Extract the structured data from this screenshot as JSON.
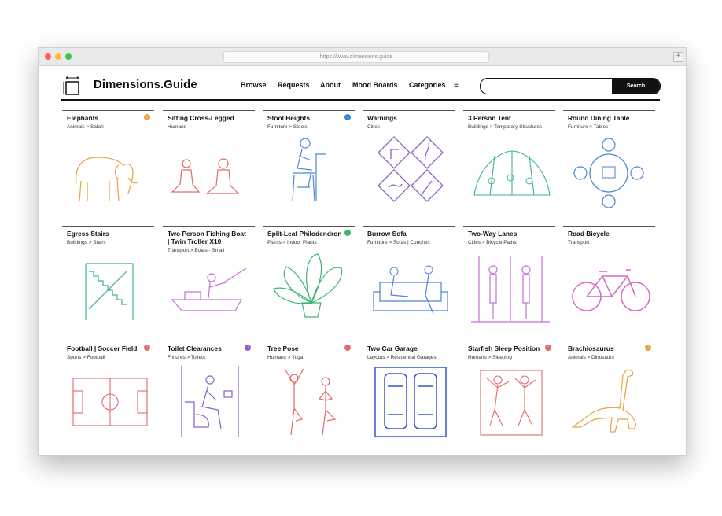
{
  "browser": {
    "url": "https://www.dimensions.guide",
    "new_tab_icon": "+"
  },
  "site": {
    "brand": "Dimensions.Guide",
    "logo_icon": "dimensions-logo-icon"
  },
  "nav": {
    "browse": "Browse",
    "requests": "Requests",
    "about": "About",
    "mood_boards": "Mood Boards",
    "categories": "Categories",
    "menu_icon": "≡"
  },
  "search": {
    "placeholder": "",
    "button": "Search"
  },
  "cards": [
    {
      "title": "Elephants",
      "sub": "Animals > Safari",
      "color": "#e8a243",
      "icon": "elephant-icon",
      "badge": "orange"
    },
    {
      "title": "Sitting Cross-Legged",
      "sub": "Humans",
      "color": "#e36a6a",
      "icon": "sitting-people-icon",
      "badge": ""
    },
    {
      "title": "Stool Heights",
      "sub": "Furniture > Stools",
      "color": "#4a86d6",
      "icon": "stool-person-icon",
      "badge": "blue"
    },
    {
      "title": "Warnings",
      "sub": "Cities",
      "color": "#8a5fc7",
      "icon": "warning-signs-icon",
      "badge": ""
    },
    {
      "title": "3 Person Tent",
      "sub": "Buildings > Temporary Structures",
      "color": "#3db58a",
      "icon": "tent-icon",
      "badge": ""
    },
    {
      "title": "Round Dining Table",
      "sub": "Furniture > Tables",
      "color": "#4a86d6",
      "icon": "dining-table-icon",
      "badge": ""
    },
    {
      "title": "Egress Stairs",
      "sub": "Buildings > Stairs",
      "color": "#3db58a",
      "icon": "stairs-icon",
      "badge": ""
    },
    {
      "title": "Two Person Fishing Boat | Twin Troller X10",
      "sub": "Transport > Boats - Small",
      "color": "#c56fd6",
      "icon": "fishing-boat-icon",
      "badge": ""
    },
    {
      "title": "Split-Leaf Philodendron",
      "sub": "Plants > Indoor Plants",
      "color": "#3db573",
      "icon": "plant-icon",
      "badge": "green"
    },
    {
      "title": "Burrow Sofa",
      "sub": "Furniture > Sofas | Couches",
      "color": "#4a86d6",
      "icon": "sofa-icon",
      "badge": ""
    },
    {
      "title": "Two-Way Lanes",
      "sub": "Cities > Bicycle Paths",
      "color": "#c56fd6",
      "icon": "bicycle-lanes-icon",
      "badge": ""
    },
    {
      "title": "Road Bicycle",
      "sub": "Transport",
      "color": "#d468c6",
      "icon": "bicycle-icon",
      "badge": ""
    },
    {
      "title": "Football | Soccer Field",
      "sub": "Sports > Football",
      "color": "#e36a6a",
      "icon": "soccer-field-icon",
      "badge": "red"
    },
    {
      "title": "Toilet Clearances",
      "sub": "Fixtures > Toilets",
      "color": "#8a5fc7",
      "icon": "toilet-icon",
      "badge": "purple"
    },
    {
      "title": "Tree Pose",
      "sub": "Humans > Yoga",
      "color": "#e36a6a",
      "icon": "yoga-pose-icon",
      "badge": "red"
    },
    {
      "title": "Two Car Garage",
      "sub": "Layouts > Residential Garages",
      "color": "#3457c9",
      "icon": "garage-icon",
      "badge": ""
    },
    {
      "title": "Starfish Sleep Position",
      "sub": "Humans > Sleeping",
      "color": "#e36a6a",
      "icon": "sleeping-people-icon",
      "badge": "red"
    },
    {
      "title": "Brachiosaurus",
      "sub": "Animals > Dinosaurs",
      "color": "#e8a243",
      "icon": "dinosaur-icon",
      "badge": "orange"
    }
  ],
  "colors": {
    "orange": "#e8a243",
    "blue": "#3a86d8",
    "green": "#3db573",
    "red": "#e36a6a",
    "purple": "#8a5fc7"
  }
}
